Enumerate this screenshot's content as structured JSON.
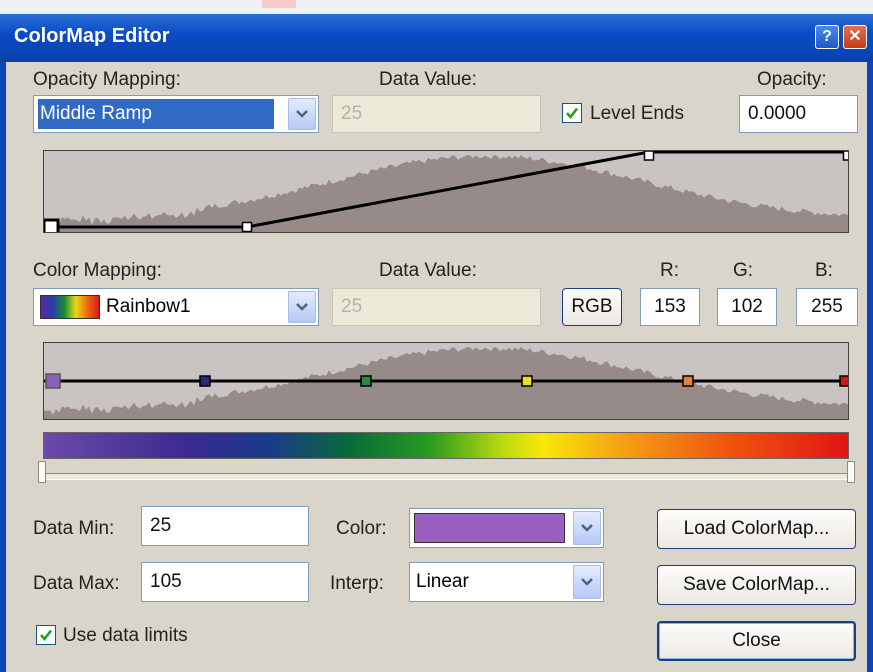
{
  "window": {
    "title": "ColorMap Editor",
    "help_label": "?",
    "close_label": "✕"
  },
  "opacity": {
    "mapping_label": "Opacity Mapping:",
    "mapping_value": "Middle Ramp",
    "data_value_label": "Data Value:",
    "data_value": "25",
    "level_ends_label": "Level Ends",
    "level_ends_checked": true,
    "opacity_label": "Opacity:",
    "opacity_value": "0.0000"
  },
  "color": {
    "mapping_label": "Color Mapping:",
    "mapping_value": "Rainbow1",
    "data_value_label": "Data Value:",
    "data_value": "25",
    "rgb_button_label": "RGB",
    "r_label": "R:",
    "g_label": "G:",
    "b_label": "B:",
    "r_value": "153",
    "g_value": "102",
    "b_value": "255",
    "control_point_colors": [
      "#8a5fb8",
      "#2a2a7a",
      "#2a8a3a",
      "#e8e020",
      "#e8803a",
      "#d01818"
    ]
  },
  "limits": {
    "data_min_label": "Data Min:",
    "data_min_value": "25",
    "data_max_label": "Data Max:",
    "data_max_value": "105",
    "use_data_limits_label": "Use data limits",
    "use_data_limits_checked": true
  },
  "selection": {
    "color_label": "Color:",
    "color_value": "#9a5fbf",
    "interp_label": "Interp:",
    "interp_value": "Linear"
  },
  "buttons": {
    "load_label": "Load ColorMap...",
    "save_label": "Save ColorMap...",
    "close_label": "Close"
  },
  "colors": {
    "title_bar": "#0a46b8",
    "dialog_face": "#d9d5cb",
    "histogram_fill": "#968b88",
    "histogram_bg": "#c9c3c1",
    "selection": "#316ac5"
  }
}
